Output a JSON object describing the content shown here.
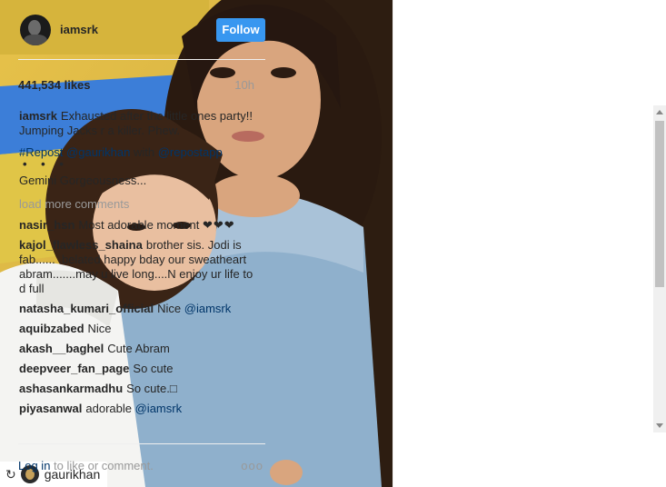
{
  "post": {
    "username": "iamsrk",
    "follow_label": "Follow",
    "likes": "441,534 likes",
    "time": "10h",
    "caption_user": "iamsrk",
    "caption_text": "Exhausted after the little ones party!! Jumping Jacks r a killer. Phew.",
    "repost_hashtag": "#Repost",
    "repost_user": "@gaurikhan",
    "repost_with": "with",
    "repost_app": "@repostapp",
    "repost_dots": "• • •",
    "repost_text": "Gemini Gorgeousness...",
    "load_more": "load more comments",
    "comments": [
      {
        "user": "nasir_hsn",
        "text": "Most adorable moment",
        "extra": "❤❤❤"
      },
      {
        "user": "kajol_flawless_shaina",
        "text": "brother sis. Jodi is fab...... .belated happy bday our sweatheart abram.......may u live long....N enjoy ur life to d full"
      },
      {
        "user": "natasha_kumari_official",
        "text": "Nice",
        "mention": "@iamsrk"
      },
      {
        "user": "aquibzabed",
        "text": "Nice"
      },
      {
        "user": "akash__baghel",
        "text": "Cute Abram"
      },
      {
        "user": "deepveer_fan_page",
        "text": "So cute"
      },
      {
        "user": "ashasankarmadhu",
        "text": "So cute.",
        "extra": "□"
      },
      {
        "user": "piyasanwal",
        "text": "adorable",
        "mention": "@iamsrk"
      }
    ],
    "login_link": "Log in",
    "login_text": "to like or comment.",
    "more_icon": "ooo"
  },
  "repost_tag": {
    "icon": "repost-icon",
    "name": "gaurikhan"
  }
}
